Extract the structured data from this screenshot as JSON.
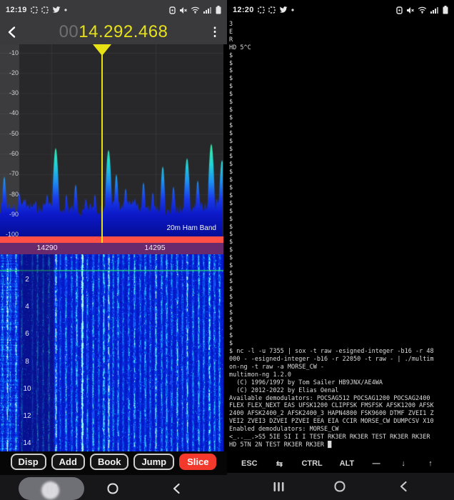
{
  "left": {
    "statusbar": {
      "time": "12:19",
      "left_icons": [
        "screenshot-icon",
        "screenshot-icon",
        "twitter-icon",
        "dot-icon"
      ],
      "right_icons": [
        "sim-lock-icon",
        "mute-icon",
        "wifi-icon",
        "signal-icon",
        "battery-icon"
      ]
    },
    "header": {
      "freq_prefix": "00",
      "frequency": "14.292.468",
      "menu_glyph": "⋮"
    },
    "spectrum": {
      "type": "area",
      "ylabel": "dB",
      "db_ticks": [
        "-10",
        "-20",
        "-30",
        "-40",
        "-50",
        "-60",
        "-70",
        "-80",
        "-90",
        "-100"
      ],
      "ylim": [
        -105,
        -5
      ],
      "noise_floor_db": -87,
      "peaks": [
        {
          "x": 6,
          "db": -71
        },
        {
          "x": 27,
          "db": -79
        },
        {
          "x": 50,
          "db": -83
        },
        {
          "x": 66,
          "db": -80
        },
        {
          "x": 78,
          "db": -57
        },
        {
          "x": 93,
          "db": -80
        },
        {
          "x": 106,
          "db": -75
        },
        {
          "x": 120,
          "db": -82
        },
        {
          "x": 133,
          "db": -80
        },
        {
          "x": 152,
          "db": -58
        },
        {
          "x": 163,
          "db": -70
        },
        {
          "x": 176,
          "db": -77
        },
        {
          "x": 189,
          "db": -82
        },
        {
          "x": 201,
          "db": -74
        },
        {
          "x": 214,
          "db": -79
        },
        {
          "x": 228,
          "db": -66
        },
        {
          "x": 243,
          "db": -76
        },
        {
          "x": 262,
          "db": -62
        },
        {
          "x": 277,
          "db": -73
        },
        {
          "x": 296,
          "db": -55
        },
        {
          "x": 311,
          "db": -63
        }
      ],
      "band_label": "20m Ham Band",
      "marker_x": 143,
      "marker_color": "#e8e214"
    },
    "freq_scale": {
      "ticks": [
        {
          "label": "14290",
          "x": 66
        },
        {
          "label": "14295",
          "x": 217
        }
      ],
      "bar_color": "#682a6c",
      "strip_color": "#ff4f47"
    },
    "waterfall": {
      "time_ticks": [
        "2",
        "4",
        "6",
        "8",
        "10",
        "12",
        "14"
      ],
      "carrier_x": 115,
      "green_line_row": 22,
      "signal_columns": [
        {
          "x": 3,
          "s": 0.5
        },
        {
          "x": 10,
          "s": 0.7
        },
        {
          "x": 14,
          "s": 0.4
        },
        {
          "x": 22,
          "s": 0.6
        },
        {
          "x": 30,
          "s": 0.45
        },
        {
          "x": 45,
          "s": 0.35
        },
        {
          "x": 52,
          "s": 0.5
        },
        {
          "x": 60,
          "s": 0.4
        },
        {
          "x": 68,
          "s": 0.55
        },
        {
          "x": 78,
          "s": 0.75
        },
        {
          "x": 84,
          "s": 0.4
        },
        {
          "x": 92,
          "s": 0.6
        },
        {
          "x": 100,
          "s": 0.45
        },
        {
          "x": 107,
          "s": 0.65
        },
        {
          "x": 115,
          "s": 1.0
        },
        {
          "x": 122,
          "s": 0.5
        },
        {
          "x": 130,
          "s": 0.6
        },
        {
          "x": 138,
          "s": 0.45
        },
        {
          "x": 145,
          "s": 0.7
        },
        {
          "x": 152,
          "s": 0.8
        },
        {
          "x": 158,
          "s": 0.5
        },
        {
          "x": 165,
          "s": 0.6
        },
        {
          "x": 172,
          "s": 0.4
        },
        {
          "x": 180,
          "s": 0.55
        },
        {
          "x": 188,
          "s": 0.65
        },
        {
          "x": 196,
          "s": 0.5
        },
        {
          "x": 203,
          "s": 0.6
        },
        {
          "x": 210,
          "s": 0.45
        },
        {
          "x": 218,
          "s": 0.7
        },
        {
          "x": 226,
          "s": 0.55
        },
        {
          "x": 233,
          "s": 0.6
        },
        {
          "x": 240,
          "s": 0.5
        },
        {
          "x": 248,
          "s": 0.65
        },
        {
          "x": 255,
          "s": 0.45
        },
        {
          "x": 262,
          "s": 0.7
        },
        {
          "x": 270,
          "s": 0.5
        },
        {
          "x": 278,
          "s": 0.6
        },
        {
          "x": 285,
          "s": 0.5
        },
        {
          "x": 293,
          "s": 0.75
        },
        {
          "x": 300,
          "s": 0.55
        },
        {
          "x": 307,
          "s": 0.6
        }
      ]
    },
    "buttons": [
      {
        "label": "Disp",
        "accent": false
      },
      {
        "label": "Add",
        "accent": false
      },
      {
        "label": "Book",
        "accent": false
      },
      {
        "label": "Jump",
        "accent": false
      },
      {
        "label": "Slice",
        "accent": true
      }
    ],
    "accent_color": "#f3392b"
  },
  "right": {
    "statusbar": {
      "time": "12:20",
      "left_icons": [
        "screenshot-icon",
        "screenshot-icon",
        "twitter-icon",
        "dot-icon"
      ],
      "right_icons": [
        "sim-lock-icon",
        "mute-icon",
        "wifi-icon",
        "signal-icon",
        "battery-icon"
      ]
    },
    "terminal": {
      "lines": [
        "3",
        "E",
        "R",
        "HD 5^C",
        "$",
        "$",
        "$",
        "$",
        "$",
        "$",
        "$",
        "$",
        "$",
        "$",
        "$",
        "$",
        "$",
        "$",
        "$",
        "$",
        "$",
        "$",
        "$",
        "$",
        "$",
        "$",
        "$",
        "$",
        "$",
        "$",
        "$",
        "$",
        "$",
        "$",
        "$",
        "$",
        "$",
        "$",
        "$",
        "$",
        "$",
        "$",
        "$ nc -l -u 7355 | sox -t raw -esigned-integer -b16 -r 48",
        "000 - -esigned-integer -b16 -r 22050 -t raw - | ./multim",
        "on-ng -t raw -a MORSE_CW -",
        "multimon-ng 1.2.0",
        "  (C) 1996/1997 by Tom Sailer HB9JNX/AE4WA",
        "  (C) 2012-2022 by Elias Oenal",
        "Available demodulators: POCSAG512 POCSAG1200 POCSAG2400",
        "FLEX FLEX_NEXT EAS UFSK1200 CLIPFSK FMSFSK AFSK1200 AFSK",
        "2400 AFSK2400_2 AFSK2400_3 HAPN4800 FSK9600 DTMF ZVEI1 Z",
        "VEI2 ZVEI3 DZVEI PZVEI EEA EIA CCIR MORSE_CW DUMPCSV X10",
        "Enabled demodulators: MORSE_CW",
        "<_..__.>S5 5IE SI I I TEST RK3ER RK3ER TEST RK3ER RK3ER",
        "HD 5TN 2N TEST RK3ER RK3ER █"
      ]
    },
    "extra_keys": [
      "ESC",
      "⇆",
      "CTRL",
      "ALT",
      "—",
      "↓",
      "↑"
    ]
  }
}
